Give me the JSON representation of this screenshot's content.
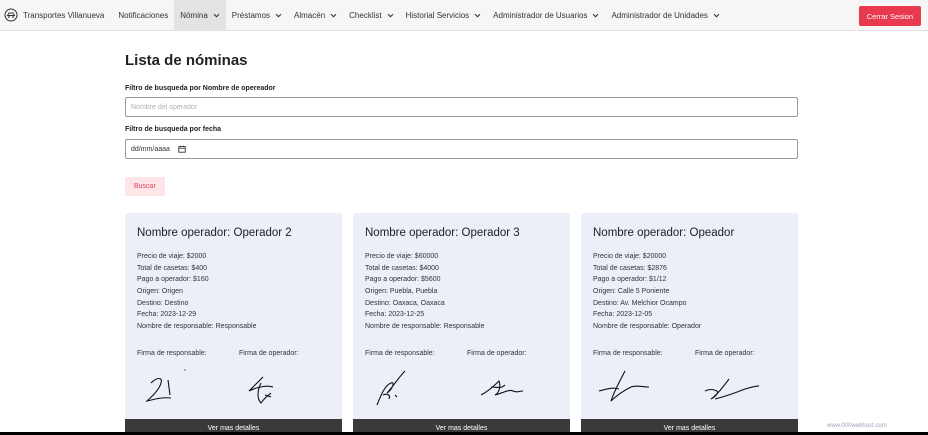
{
  "navbar": {
    "brand": "Transportes Villanueva",
    "items": [
      {
        "label": "Notificaciones",
        "dropdown": false
      },
      {
        "label": "Nómina",
        "dropdown": true,
        "active": true
      },
      {
        "label": "Préstamos",
        "dropdown": true
      },
      {
        "label": "Almacén",
        "dropdown": true
      },
      {
        "label": "Checklist",
        "dropdown": true
      },
      {
        "label": "Historial Servicios",
        "dropdown": true
      },
      {
        "label": "Administrador de Usuarios",
        "dropdown": true
      },
      {
        "label": "Administrador de Unidades",
        "dropdown": true
      }
    ],
    "logout_label": "Cerrar Sesion"
  },
  "main": {
    "title": "Lista de nóminas",
    "name_filter_label": "Filtro de busqueda por Nombre de opereador",
    "name_filter_placeholder": "Nombre del operador",
    "date_filter_label": "Filtro de busqueda por fecha",
    "date_filter_value": "dd/mm/aaaa",
    "search_label": "Buscar"
  },
  "cards": [
    {
      "title": "Nombre operador: Operador 2",
      "precio": "Precio de viaje: $2000",
      "casetas": "Total de casetas: $400",
      "pago": "Pago a operador: $160",
      "origen": "Origen: Origen",
      "destino": "Destino: Destino",
      "fecha": "Fecha: 2023-12-29",
      "responsable": "Nombre de responsable: Responsable",
      "firma_responsable": "Firma de responsable:",
      "firma_operador": "Firma de operador:",
      "details": "Ver mas detalles"
    },
    {
      "title": "Nombre operador: Operador 3",
      "precio": "Precio de viaje: $60000",
      "casetas": "Total de casetas: $4000",
      "pago": "Pago a operador: $5600",
      "origen": "Origen: Puebla, Puebla",
      "destino": "Destino: Oaxaca, Oaxaca",
      "fecha": "Fecha: 2023-12-25",
      "responsable": "Nombre de responsable: Responsable",
      "firma_responsable": "Firma de responsable:",
      "firma_operador": "Firma de operador:",
      "details": "Ver mas detalles"
    },
    {
      "title": "Nombre operador: Opeador",
      "precio": "Precio de viaje: $20000",
      "casetas": "Total de casetas: $2876",
      "pago": "Pago a operador: $1/12",
      "origen": "Origen: Calle 5 Poniente",
      "destino": "Destino: Av. Melchior Ocampo",
      "fecha": "Fecha: 2023-12-05",
      "responsable": "Nombre de responsable: Operador",
      "firma_responsable": "Firma de responsable:",
      "firma_operador": "Firma de operador:",
      "details": "Ver mas detalles"
    }
  ],
  "footer_badge": "www.000webhost.com",
  "colors": {
    "logout_bg": "#e8394f",
    "search_bg": "#fde5e8",
    "search_text": "#e0405a",
    "card_bg": "#eceef8",
    "details_bg": "#3a3a3a"
  },
  "icons": [
    "car-icon",
    "chevron-down-icon",
    "calendar-icon",
    "signature-image"
  ]
}
